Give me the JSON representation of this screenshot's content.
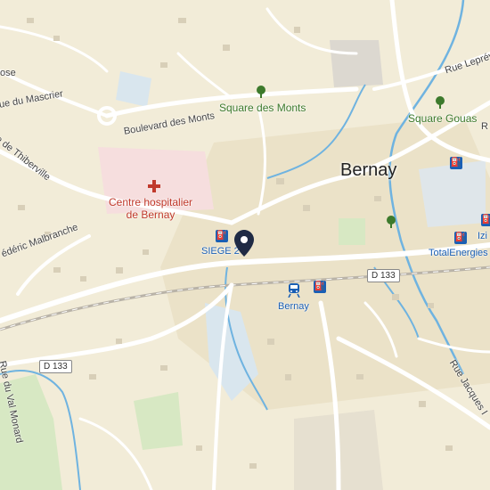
{
  "streets": {
    "rose": "ose",
    "mascrier": "ue du Mascrier",
    "thiberville": "e de Thiberville",
    "malbranche": "édéric Malbranche",
    "boulevard_monts": "Boulevard des Monts",
    "leprevost": "Rue Leprévo",
    "val_monard": "Rue du Val Monard",
    "jacques": "Rue Jacques I",
    "r_edge": "R"
  },
  "parks": {
    "square_monts": "Square des Monts",
    "square_gouas": "Square Gouas"
  },
  "pois": {
    "hospital_line1": "Centre hospitalier",
    "hospital_line2": "de Bernay",
    "siege": "SIEGE 2",
    "station": "Bernay",
    "total": "TotalEnergies",
    "izi": "Izi"
  },
  "city": "Bernay",
  "roads": {
    "d133_a": "D 133",
    "d133_b": "D 133"
  },
  "icons": [
    "tree-icon",
    "fuel-icon",
    "train-icon",
    "hospital-cross-icon",
    "location-pin-icon"
  ],
  "colors": {
    "land": "#f2ecd8",
    "water": "#6fb3e0",
    "park": "#d7e8c3",
    "road": "#ffffff",
    "pin": "#1f2a44",
    "poi_blue": "#1a5fb4"
  }
}
